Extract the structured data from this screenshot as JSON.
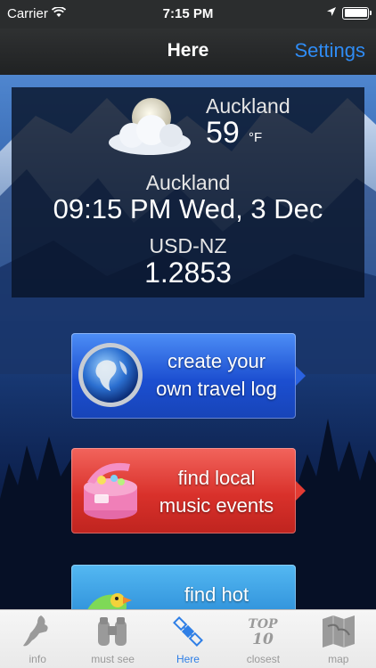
{
  "status_bar": {
    "carrier": "Carrier",
    "time": "7:15 PM",
    "battery_level": 1.0
  },
  "nav": {
    "title": "Here",
    "settings_label": "Settings"
  },
  "weather": {
    "city": "Auckland",
    "temperature": "59",
    "unit": "°F",
    "icon": "night-cloud-moon-icon"
  },
  "clock": {
    "city": "Auckland",
    "datetime": "09:15 PM Wed, 3 Dec"
  },
  "currency": {
    "pair": "USD-NZ",
    "rate": "1.2853"
  },
  "features": [
    {
      "label_line1": "create your",
      "label_line2": "own travel log",
      "icon": "globe-icon",
      "color": "#2a62e0"
    },
    {
      "label_line1": "find local",
      "label_line2": "music events",
      "icon": "music-box-icon",
      "color": "#e23b33"
    },
    {
      "label_line1": "find hot",
      "label_line2": "",
      "icon": "parrot-icon",
      "color": "#3ba3e6"
    }
  ],
  "tabs": [
    {
      "label": "info",
      "icon": "new-zealand-map-icon",
      "active": false
    },
    {
      "label": "must see",
      "icon": "binoculars-icon",
      "active": false
    },
    {
      "label": "Here",
      "icon": "satellite-icon",
      "active": true
    },
    {
      "label": "closest",
      "icon": "top-10-icon",
      "active": false,
      "icon_text_line1": "TOP",
      "icon_text_line2": "10"
    },
    {
      "label": "map",
      "icon": "folded-map-icon",
      "active": false
    }
  ],
  "colors": {
    "accent": "#2f8cf5",
    "active_tab": "#2f7fe6",
    "inactive_tab": "#9a9a9a"
  }
}
